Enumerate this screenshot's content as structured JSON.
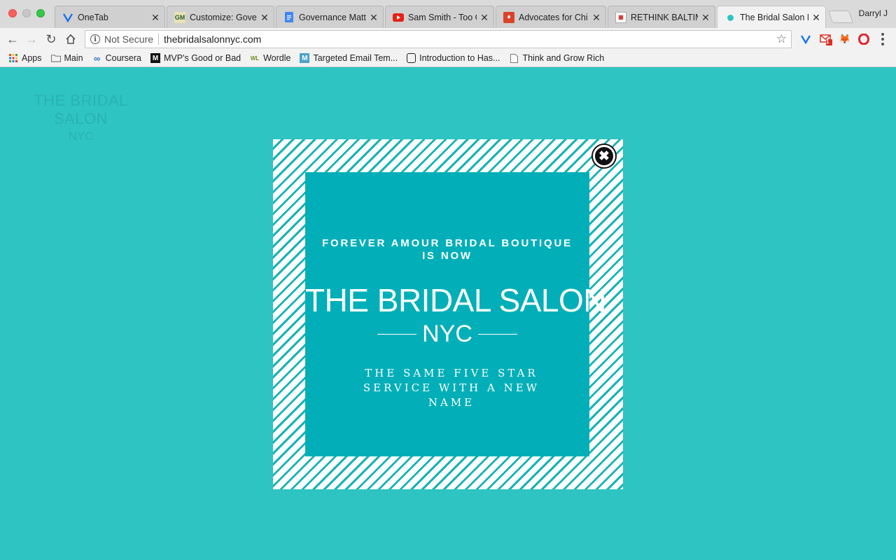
{
  "browser": {
    "tabs": [
      {
        "title": "OneTab",
        "icon": "onetab-icon"
      },
      {
        "title": "Customize: Gover",
        "icon": "gm-icon"
      },
      {
        "title": "Governance Matte",
        "icon": "google-docs-icon"
      },
      {
        "title": "Sam Smith - Too G",
        "icon": "youtube-icon"
      },
      {
        "title": "Advocates for Chi",
        "icon": "advocates-icon"
      },
      {
        "title": "RETHINK BALTIMO",
        "icon": "rethink-icon"
      },
      {
        "title": "The Bridal Salon N",
        "icon": "bridal-dot-icon"
      }
    ],
    "profile_name": "Darryl J",
    "security_label": "Not Secure",
    "url": "thebridalsalonnyc.com",
    "bookmarks": [
      {
        "label": "Apps",
        "icon": "apps-grid-icon"
      },
      {
        "label": "Main",
        "icon": "folder-icon"
      },
      {
        "label": "Coursera",
        "icon": "coursera-icon"
      },
      {
        "label": "MVP's Good or Bad",
        "icon": "medium-icon"
      },
      {
        "label": "Wordle",
        "icon": "wordle-icon"
      },
      {
        "label": "Targeted Email Tem...",
        "icon": "mailchimp-icon"
      },
      {
        "label": "Introduction to Has...",
        "icon": "hashgraph-icon"
      },
      {
        "label": "Think and Grow Rich",
        "icon": "page-icon"
      }
    ],
    "extension_badge": "1"
  },
  "site": {
    "logo_line1": "THE BRIDAL SALON",
    "logo_line2": "NYC"
  },
  "popup": {
    "headline": "FOREVER AMOUR BRIDAL BOUTIQUE IS NOW",
    "brand_name": "THE BRIDAL SALON",
    "brand_sub": "NYC",
    "tagline": "THE SAME FIVE STAR SERVICE WITH A NEW NAME",
    "close_symbol": "✖"
  },
  "colors": {
    "page_bg": "#2ec4c1",
    "popup_inner": "#02afb8",
    "stripe": "#17b3b6"
  }
}
